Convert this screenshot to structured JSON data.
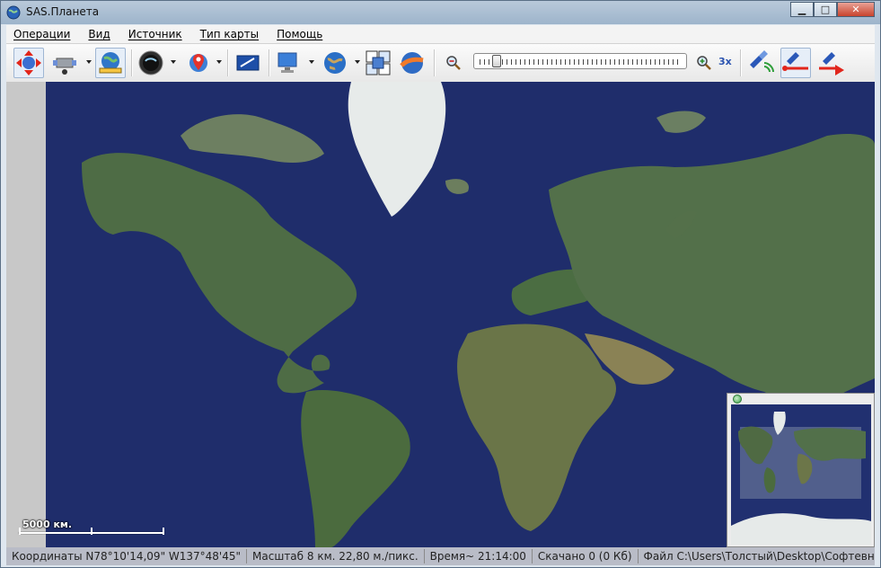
{
  "window": {
    "title": "SAS.Планета"
  },
  "menu": {
    "items": [
      {
        "label": "Операции"
      },
      {
        "label": "Вид"
      },
      {
        "label": "Источник"
      },
      {
        "label": "Тип карты"
      },
      {
        "label": "Помощь"
      }
    ]
  },
  "toolbar": {
    "zoom_label": "3x",
    "icons": [
      "move-arrows-icon",
      "gps-satellite-icon",
      "globe-ruler-icon",
      "compass-icon",
      "marker-icon",
      "fullscreen-icon",
      "computer-icon",
      "globe-map-icon",
      "layers-icon",
      "sun-globe-icon",
      "zoom-out-icon",
      "zoom-in-icon",
      "sat-wave-icon",
      "sat-line-icon",
      "sat-marker-icon"
    ]
  },
  "map": {
    "scale_label": "5000 км."
  },
  "status": {
    "coords": "Координаты N78°10'14,09\"  W137°48'45\"",
    "scale": "Масштаб 8 км. 22,80 м./пикс.",
    "time": "Время~ 21:14:00",
    "downloaded": "Скачано 0 (0 Кб)",
    "file": "Файл C:\\Users\\Толстый\\Desktop\\Софтевнны"
  },
  "colors": {
    "ocean": "#1d2a66",
    "land": "#4f6a44",
    "ice": "#e6eae9",
    "accent": "#2b53b0"
  }
}
